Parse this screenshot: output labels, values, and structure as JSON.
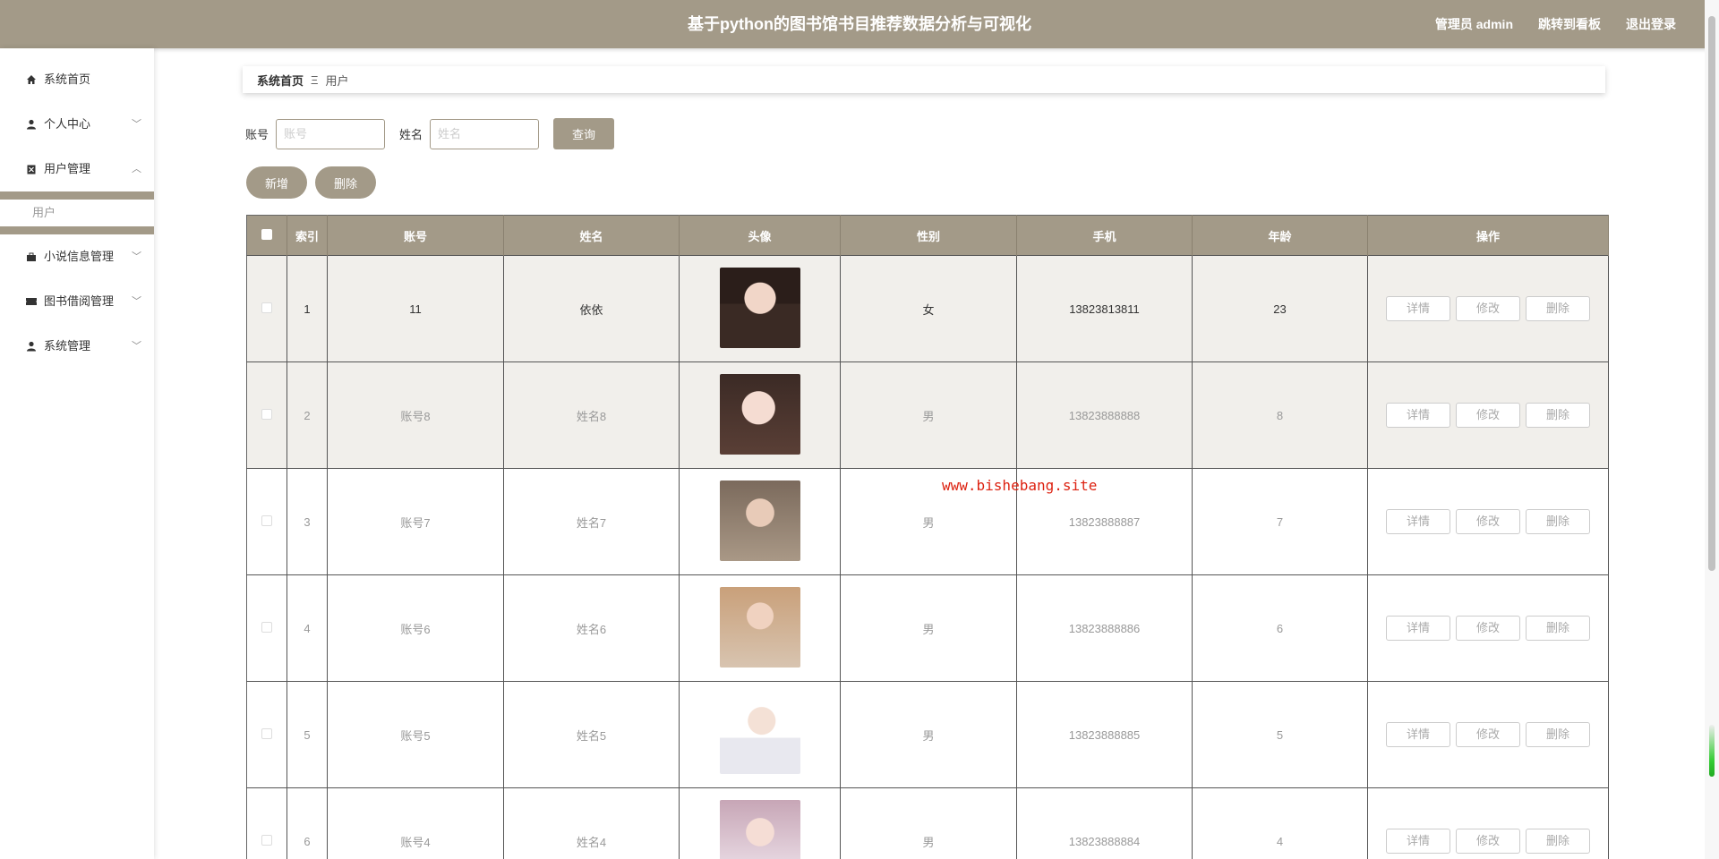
{
  "header": {
    "title": "基于python的图书馆书目推荐数据分析与可视化",
    "admin": "管理员 admin",
    "dashboard_link": "跳转到看板",
    "logout": "退出登录"
  },
  "sidebar": {
    "items": [
      {
        "label": "系统首页",
        "icon": "home-icon"
      },
      {
        "label": "个人中心",
        "icon": "person-icon",
        "arrow": "﹀"
      },
      {
        "label": "用户管理",
        "icon": "clipboard-icon",
        "arrow": "︿"
      },
      {
        "label": "小说信息管理",
        "icon": "briefcase-icon",
        "arrow": "﹀"
      },
      {
        "label": "图书借阅管理",
        "icon": "ticket-icon",
        "arrow": "﹀"
      },
      {
        "label": "系统管理",
        "icon": "user-icon",
        "arrow": "﹀"
      }
    ],
    "sub_item": "用户"
  },
  "breadcrumb": {
    "home": "系统首页",
    "separator": "Ξ",
    "current": "用户"
  },
  "search": {
    "account_label": "账号",
    "account_placeholder": "账号",
    "name_label": "姓名",
    "name_placeholder": "姓名",
    "query_button": "查询"
  },
  "actions": {
    "add": "新增",
    "delete": "删除"
  },
  "table": {
    "columns": [
      "索引",
      "账号",
      "姓名",
      "头像",
      "性别",
      "手机",
      "年龄",
      "操作"
    ],
    "rows": [
      {
        "index": "1",
        "account": "11",
        "name": "依依",
        "gender": "女",
        "phone": "13823813811",
        "age": "23"
      },
      {
        "index": "2",
        "account": "账号8",
        "name": "姓名8",
        "gender": "男",
        "phone": "13823888888",
        "age": "8"
      },
      {
        "index": "3",
        "account": "账号7",
        "name": "姓名7",
        "gender": "男",
        "phone": "13823888887",
        "age": "7"
      },
      {
        "index": "4",
        "account": "账号6",
        "name": "姓名6",
        "gender": "男",
        "phone": "13823888886",
        "age": "6"
      },
      {
        "index": "5",
        "account": "账号5",
        "name": "姓名5",
        "gender": "男",
        "phone": "13823888885",
        "age": "5"
      },
      {
        "index": "6",
        "account": "账号4",
        "name": "姓名4",
        "gender": "男",
        "phone": "13823888884",
        "age": "4"
      }
    ],
    "ops": {
      "detail": "详情",
      "edit": "修改",
      "delete": "删除"
    }
  },
  "watermark": "www.bishebang.site",
  "colors": {
    "accent": "#a39a88",
    "row_shade": "#f1efeb"
  }
}
